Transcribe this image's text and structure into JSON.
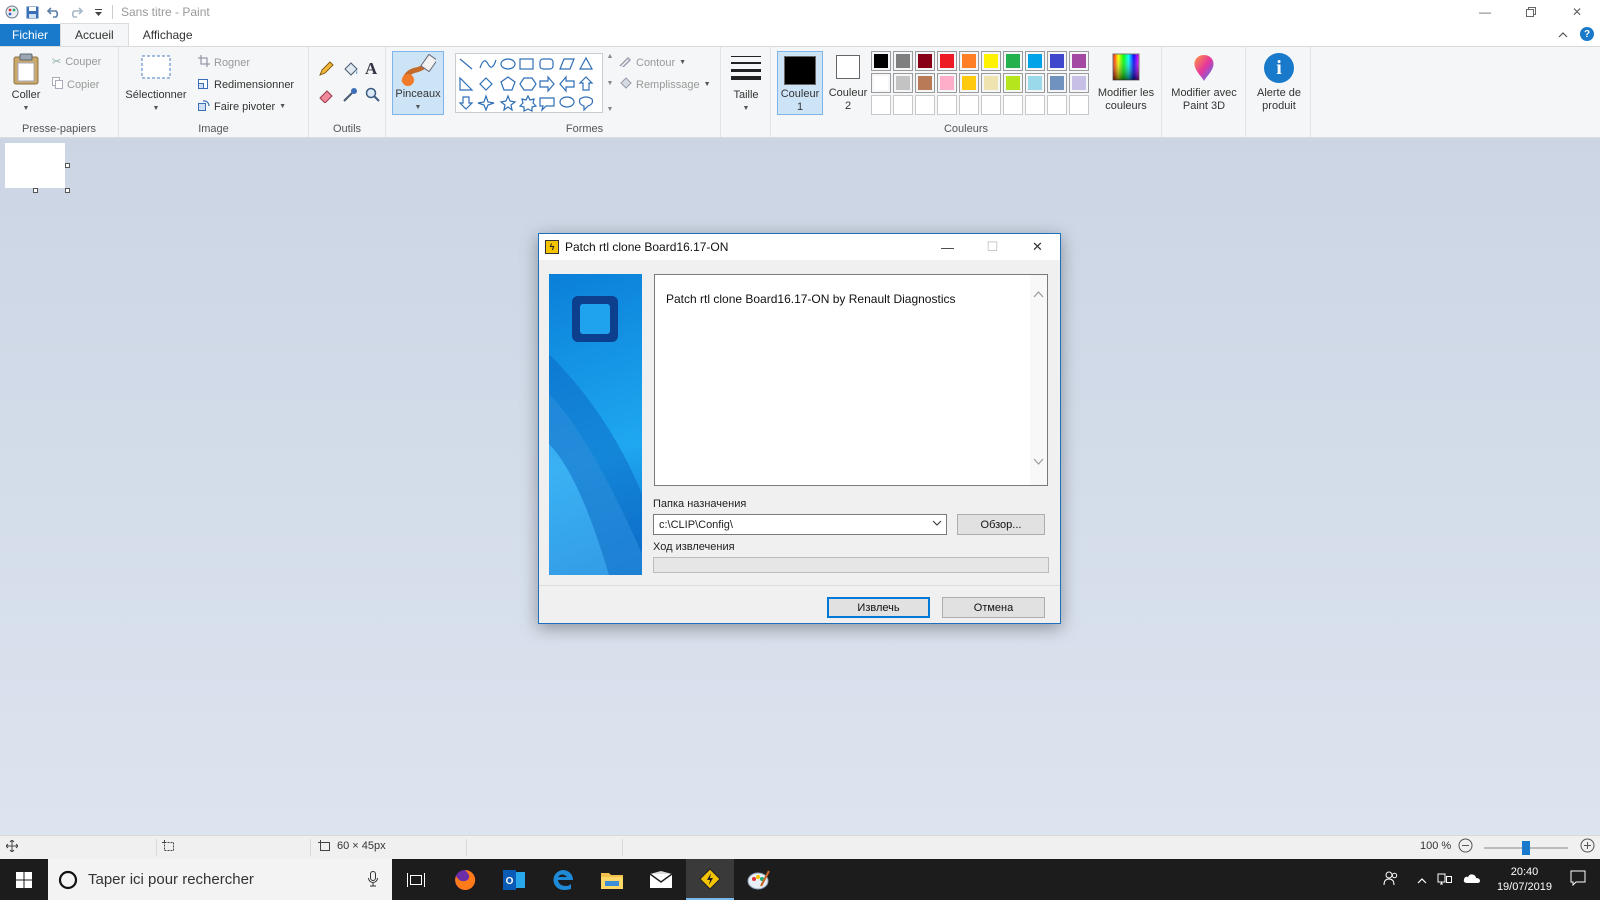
{
  "app": {
    "title": "Sans titre - Paint",
    "quick_access": [
      "save-icon",
      "undo-icon",
      "redo-icon",
      "customize-icon"
    ]
  },
  "tabs": {
    "file": "Fichier",
    "home": "Accueil",
    "view": "Affichage"
  },
  "ribbon": {
    "clipboard": {
      "paste": "Coller",
      "cut": "Couper",
      "copy": "Copier",
      "label": "Presse-papiers"
    },
    "image": {
      "select": "Sélectionner",
      "crop": "Rogner",
      "resize": "Redimensionner",
      "rotate": "Faire pivoter",
      "label": "Image"
    },
    "tools": {
      "label": "Outils"
    },
    "brushes": {
      "label": "Pinceaux"
    },
    "shapes": {
      "outline": "Contour",
      "fill": "Remplissage",
      "label": "Formes"
    },
    "size": {
      "label": "Taille"
    },
    "colors": {
      "color1": [
        "Couleur",
        "1"
      ],
      "color2": [
        "Couleur",
        "2"
      ],
      "edit": [
        "Modifier les",
        "couleurs"
      ],
      "label": "Couleurs",
      "palette_row1": [
        "#000000",
        "#7f7f7f",
        "#880015",
        "#ed1c24",
        "#ff7f27",
        "#fff200",
        "#22b14c",
        "#00a2e8",
        "#3f48cc",
        "#a349a4"
      ],
      "palette_row2": [
        "#ffffff",
        "#c3c3c3",
        "#b97a57",
        "#ffaec9",
        "#ffc90e",
        "#efe4b0",
        "#b5e61d",
        "#99d9ea",
        "#7092be",
        "#c8bfe7"
      ]
    },
    "paint3d": [
      "Modifier avec",
      "Paint 3D"
    ],
    "alert": [
      "Alerte de",
      "produit"
    ]
  },
  "dialog": {
    "title": "Patch rtl clone Board16.17-ON",
    "message": "Patch rtl clone Board16.17-ON by Renault Diagnostics",
    "dest_label": "Папка назначения",
    "dest_value": "c:\\CLIP\\Config\\",
    "browse": "Обзор...",
    "progress_label": "Ход извлечения",
    "progress": 0,
    "extract": "Извлечь",
    "cancel": "Отмена"
  },
  "status": {
    "canvas_size": "60 × 45px",
    "zoom": "100 %",
    "zoom_level": 0.5
  },
  "taskbar": {
    "search_placeholder": "Taper ici pour rechercher",
    "time": "20:40",
    "date": "19/07/2019"
  }
}
